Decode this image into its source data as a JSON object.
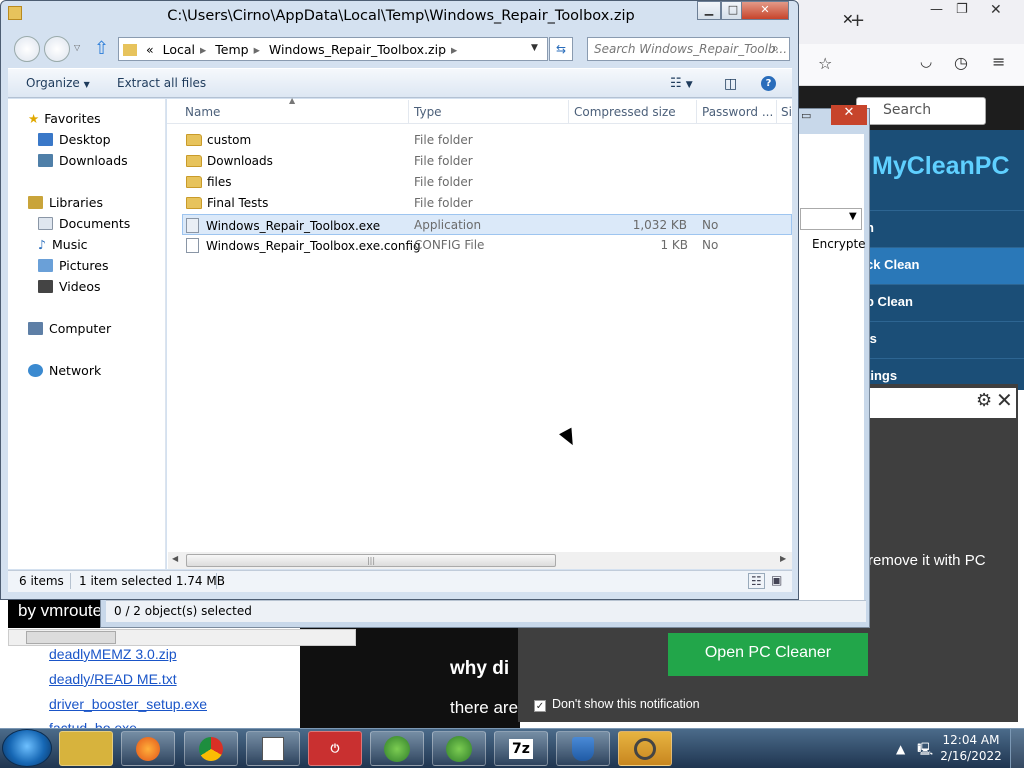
{
  "explorer": {
    "title": "C:\\Users\\Cirno\\AppData\\Local\\Temp\\Windows_Repair_Toolbox.zip",
    "address": {
      "chevron": "«",
      "crumbs": [
        "Local",
        "Temp",
        "Windows_Repair_Toolbox.zip"
      ]
    },
    "search_placeholder": "Search Windows_Repair_Toolb...",
    "toolbar": {
      "organize": "Organize",
      "extract": "Extract all files"
    },
    "nav": {
      "favorites": "Favorites",
      "favorites_items": [
        "Desktop",
        "Downloads"
      ],
      "libraries": "Libraries",
      "libraries_items": [
        "Documents",
        "Music",
        "Pictures",
        "Videos"
      ],
      "computer": "Computer",
      "network": "Network"
    },
    "columns": [
      "Name",
      "Type",
      "Compressed size",
      "Password ...",
      "Si"
    ],
    "files": [
      {
        "name": "custom",
        "type": "File folder",
        "size": "",
        "password": "",
        "kind": "folder"
      },
      {
        "name": "Downloads",
        "type": "File folder",
        "size": "",
        "password": "",
        "kind": "folder"
      },
      {
        "name": "files",
        "type": "File folder",
        "size": "",
        "password": "",
        "kind": "folder"
      },
      {
        "name": "Final Tests",
        "type": "File folder",
        "size": "",
        "password": "",
        "kind": "folder"
      },
      {
        "name": "Windows_Repair_Toolbox.exe",
        "type": "Application",
        "size": "1,032 KB",
        "password": "No",
        "kind": "app",
        "selected": true
      },
      {
        "name": "Windows_Repair_Toolbox.exe.config",
        "type": "CONFIG File",
        "size": "1 KB",
        "password": "No",
        "kind": "file"
      }
    ],
    "status": {
      "count": "6 items",
      "selection": "1 item selected 1.74 MB"
    }
  },
  "mid_window": {
    "status": "0 / 2 object(s) selected",
    "encrypt_col": "Encrypte"
  },
  "background": {
    "search": "Search",
    "mcp_logo": "MyCleanPC",
    "mcp_menu": [
      "n",
      "ck Clean",
      "p Clean",
      "ls",
      "tings"
    ],
    "notif_text": "remove it with PC",
    "notif_button": "Open PC Cleaner",
    "notif_checkbox": "Don't show this notification",
    "vmroute": "by vmroute",
    "links": [
      "deadlyMEMZ 3.0.zip",
      "deadly/READ ME.txt",
      "driver_booster_setup.exe",
      "factud_bo.exe"
    ],
    "why": "why di",
    "there": "there are"
  },
  "taskbar": {
    "apps": [
      "explorer-icon",
      "firefox-icon",
      "chrome-icon",
      "notepad-icon",
      "power-icon",
      "globe-green-icon",
      "globe-green-icon",
      "7zip-icon",
      "shield-icon",
      "sync-icon"
    ],
    "7zip_label": "7z",
    "time": "12:04 AM",
    "date": "2/16/2022"
  }
}
